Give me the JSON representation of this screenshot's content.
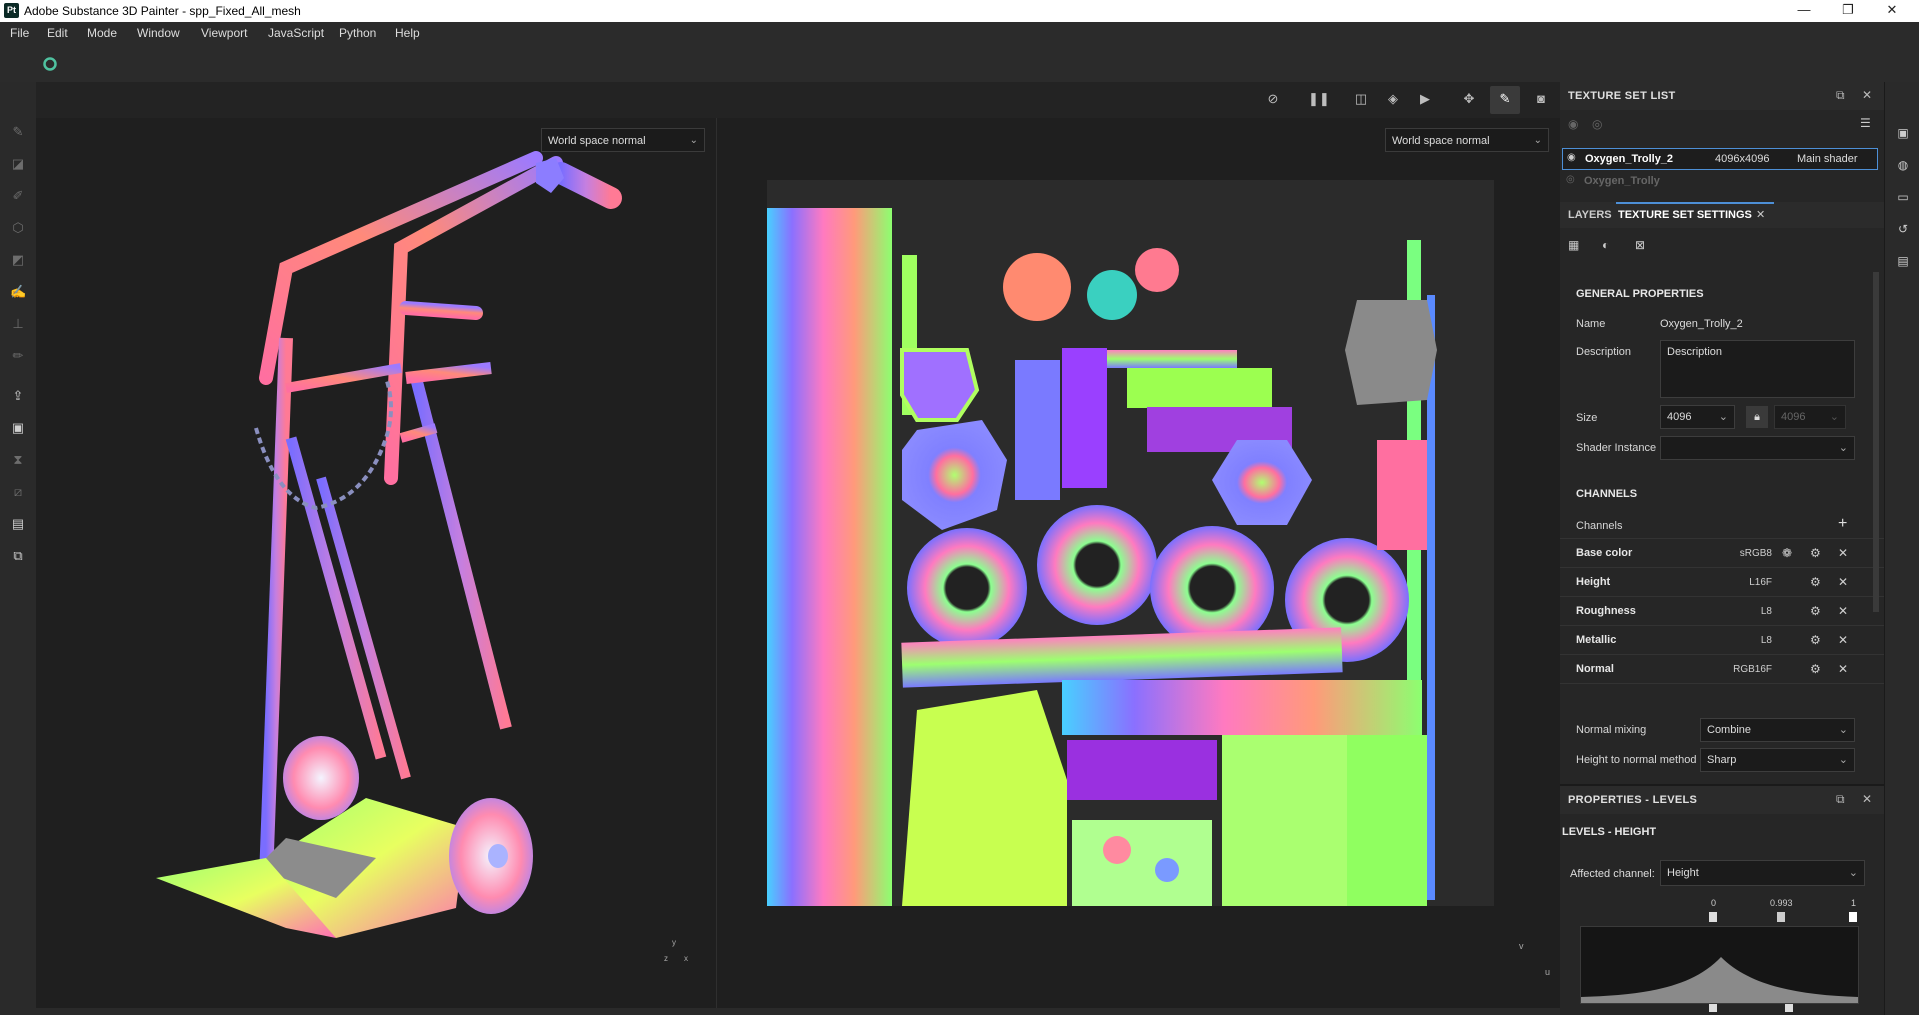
{
  "window": {
    "app_icon": "Pt",
    "title": "Adobe Substance 3D Painter - spp_Fixed_All_mesh",
    "minimize": "—",
    "maximize": "❐",
    "close": "✕"
  },
  "menu": [
    "File",
    "Edit",
    "Mode",
    "Window",
    "Viewport",
    "JavaScript",
    "Python",
    "Help"
  ],
  "viewport": {
    "left_mode": "World space normal",
    "right_mode": "World space normal",
    "axis_3d": {
      "x": "x",
      "y": "y",
      "z": "z"
    },
    "axis_2d": {
      "v": "v",
      "u": "u"
    }
  },
  "texture_set_list": {
    "title": "TEXTURE SET LIST",
    "items": [
      {
        "name": "Oxygen_Trolly_2",
        "resolution": "4096x4096",
        "shader": "Main shader",
        "selected": true
      },
      {
        "name": "Oxygen_Trolly",
        "resolution": "",
        "shader": "",
        "selected": false
      }
    ]
  },
  "tabs": {
    "layers": "LAYERS",
    "texture_set_settings": "TEXTURE SET SETTINGS",
    "close": "✕"
  },
  "general": {
    "title": "GENERAL PROPERTIES",
    "name_label": "Name",
    "name_value": "Oxygen_Trolly_2",
    "description_label": "Description",
    "description_value": "Description",
    "size_label": "Size",
    "size_value": "4096",
    "size_value_2": "4096",
    "shader_label": "Shader Instance",
    "shader_value": ""
  },
  "channels": {
    "title": "CHANNELS",
    "label": "Channels",
    "add": "+",
    "items": [
      {
        "name": "Base color",
        "format": "sRGB8"
      },
      {
        "name": "Height",
        "format": "L16F"
      },
      {
        "name": "Roughness",
        "format": "L8"
      },
      {
        "name": "Metallic",
        "format": "L8"
      },
      {
        "name": "Normal",
        "format": "RGB16F"
      }
    ],
    "normal_mixing_label": "Normal mixing",
    "normal_mixing_value": "Combine",
    "height_to_normal_label": "Height to normal method",
    "height_to_normal_value": "Sharp"
  },
  "properties": {
    "title": "PROPERTIES - LEVELS",
    "subtitle": "LEVELS - HEIGHT",
    "affected_label": "Affected channel:",
    "affected_value": "Height",
    "levels": {
      "low": "0",
      "mid": "0.993",
      "high": "1"
    }
  },
  "colors": {
    "accent": "#4d8fd6",
    "panel": "#262626",
    "background": "#1e1e1e"
  }
}
